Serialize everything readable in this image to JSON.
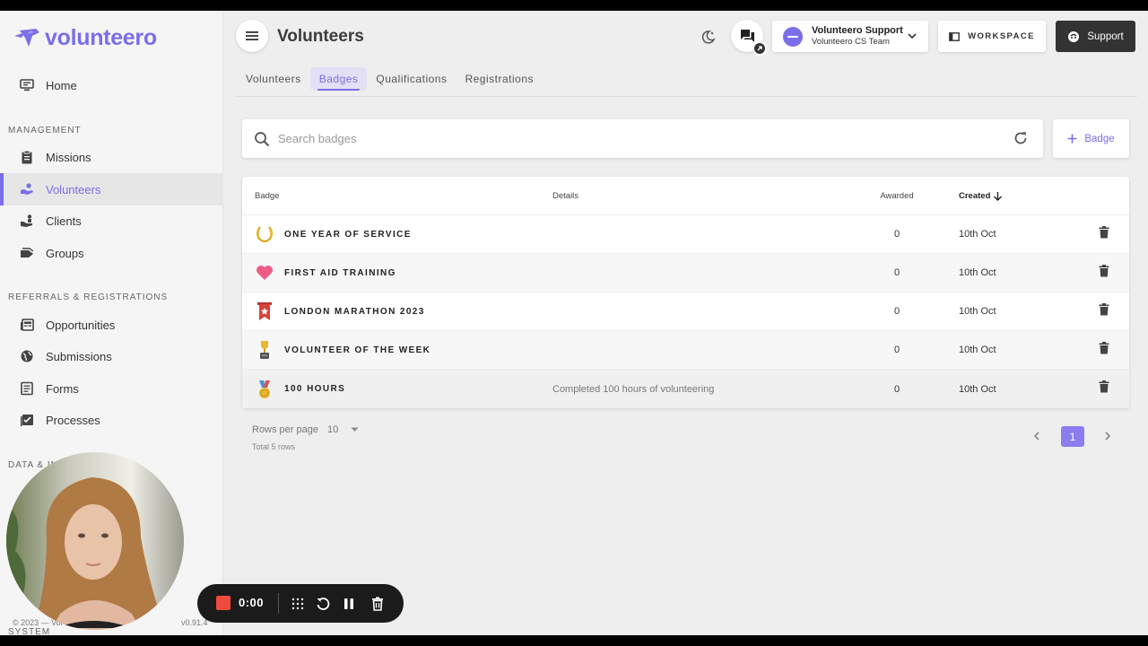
{
  "app": {
    "logo_text": "volunteero",
    "page_title": "Volunteers"
  },
  "sidebar": {
    "home_label": "Home",
    "sections": [
      {
        "label": "MANAGEMENT"
      },
      {
        "label": "REFERRALS & REGISTRATIONS"
      },
      {
        "label": "DATA & IN"
      },
      {
        "label": "SYSTEM"
      }
    ],
    "items": [
      {
        "label": "Missions",
        "icon": "clipboard-icon"
      },
      {
        "label": "Volunteers",
        "icon": "volunteer-hand-icon",
        "active": true
      },
      {
        "label": "Clients",
        "icon": "clients-icon"
      },
      {
        "label": "Groups",
        "icon": "groups-tag-icon"
      },
      {
        "label": "Opportunities",
        "icon": "newspaper-icon"
      },
      {
        "label": "Submissions",
        "icon": "globe-icon"
      },
      {
        "label": "Forms",
        "icon": "form-icon"
      },
      {
        "label": "Processes",
        "icon": "checklist-icon"
      }
    ],
    "footer_copyright": "© 2023 — Vol",
    "footer_version": "v0.91.4"
  },
  "header": {
    "account_name": "Volunteero Support",
    "account_team": "Volunteero CS Team",
    "workspace_label": "WORKSPACE",
    "support_label": "Support"
  },
  "tabs": [
    {
      "label": "Volunteers"
    },
    {
      "label": "Badges",
      "active": true
    },
    {
      "label": "Qualifications"
    },
    {
      "label": "Registrations"
    }
  ],
  "search": {
    "placeholder": "Search badges",
    "value": ""
  },
  "add_badge_label": "Badge",
  "table": {
    "columns": {
      "badge": "Badge",
      "details": "Details",
      "awarded": "Awarded",
      "created": "Created"
    },
    "rows": [
      {
        "name": "ONE YEAR OF SERVICE",
        "details": "",
        "awarded": "0",
        "created": "10th Oct",
        "icon": "laurel-wreath-icon"
      },
      {
        "name": "FIRST AID TRAINING",
        "details": "",
        "awarded": "0",
        "created": "10th Oct",
        "icon": "heart-icon"
      },
      {
        "name": "LONDON MARATHON 2023",
        "details": "",
        "awarded": "0",
        "created": "10th Oct",
        "icon": "ribbon-banner-icon"
      },
      {
        "name": "VOLUNTEER OF THE WEEK",
        "details": "",
        "awarded": "0",
        "created": "10th Oct",
        "icon": "trophy-icon"
      },
      {
        "name": "100 HOURS",
        "details": "Completed 100 hours of volunteering",
        "awarded": "0",
        "created": "10th Oct",
        "icon": "medal-icon"
      }
    ]
  },
  "pagination": {
    "rows_per_page_label": "Rows per page",
    "rows_per_page_value": "10",
    "total_label": "Total 5 rows",
    "current_page": "1"
  },
  "recorder": {
    "time": "0:00"
  },
  "colors": {
    "accent": "#7b6ee8",
    "dark_button": "#333333",
    "record": "#f04a3c"
  }
}
